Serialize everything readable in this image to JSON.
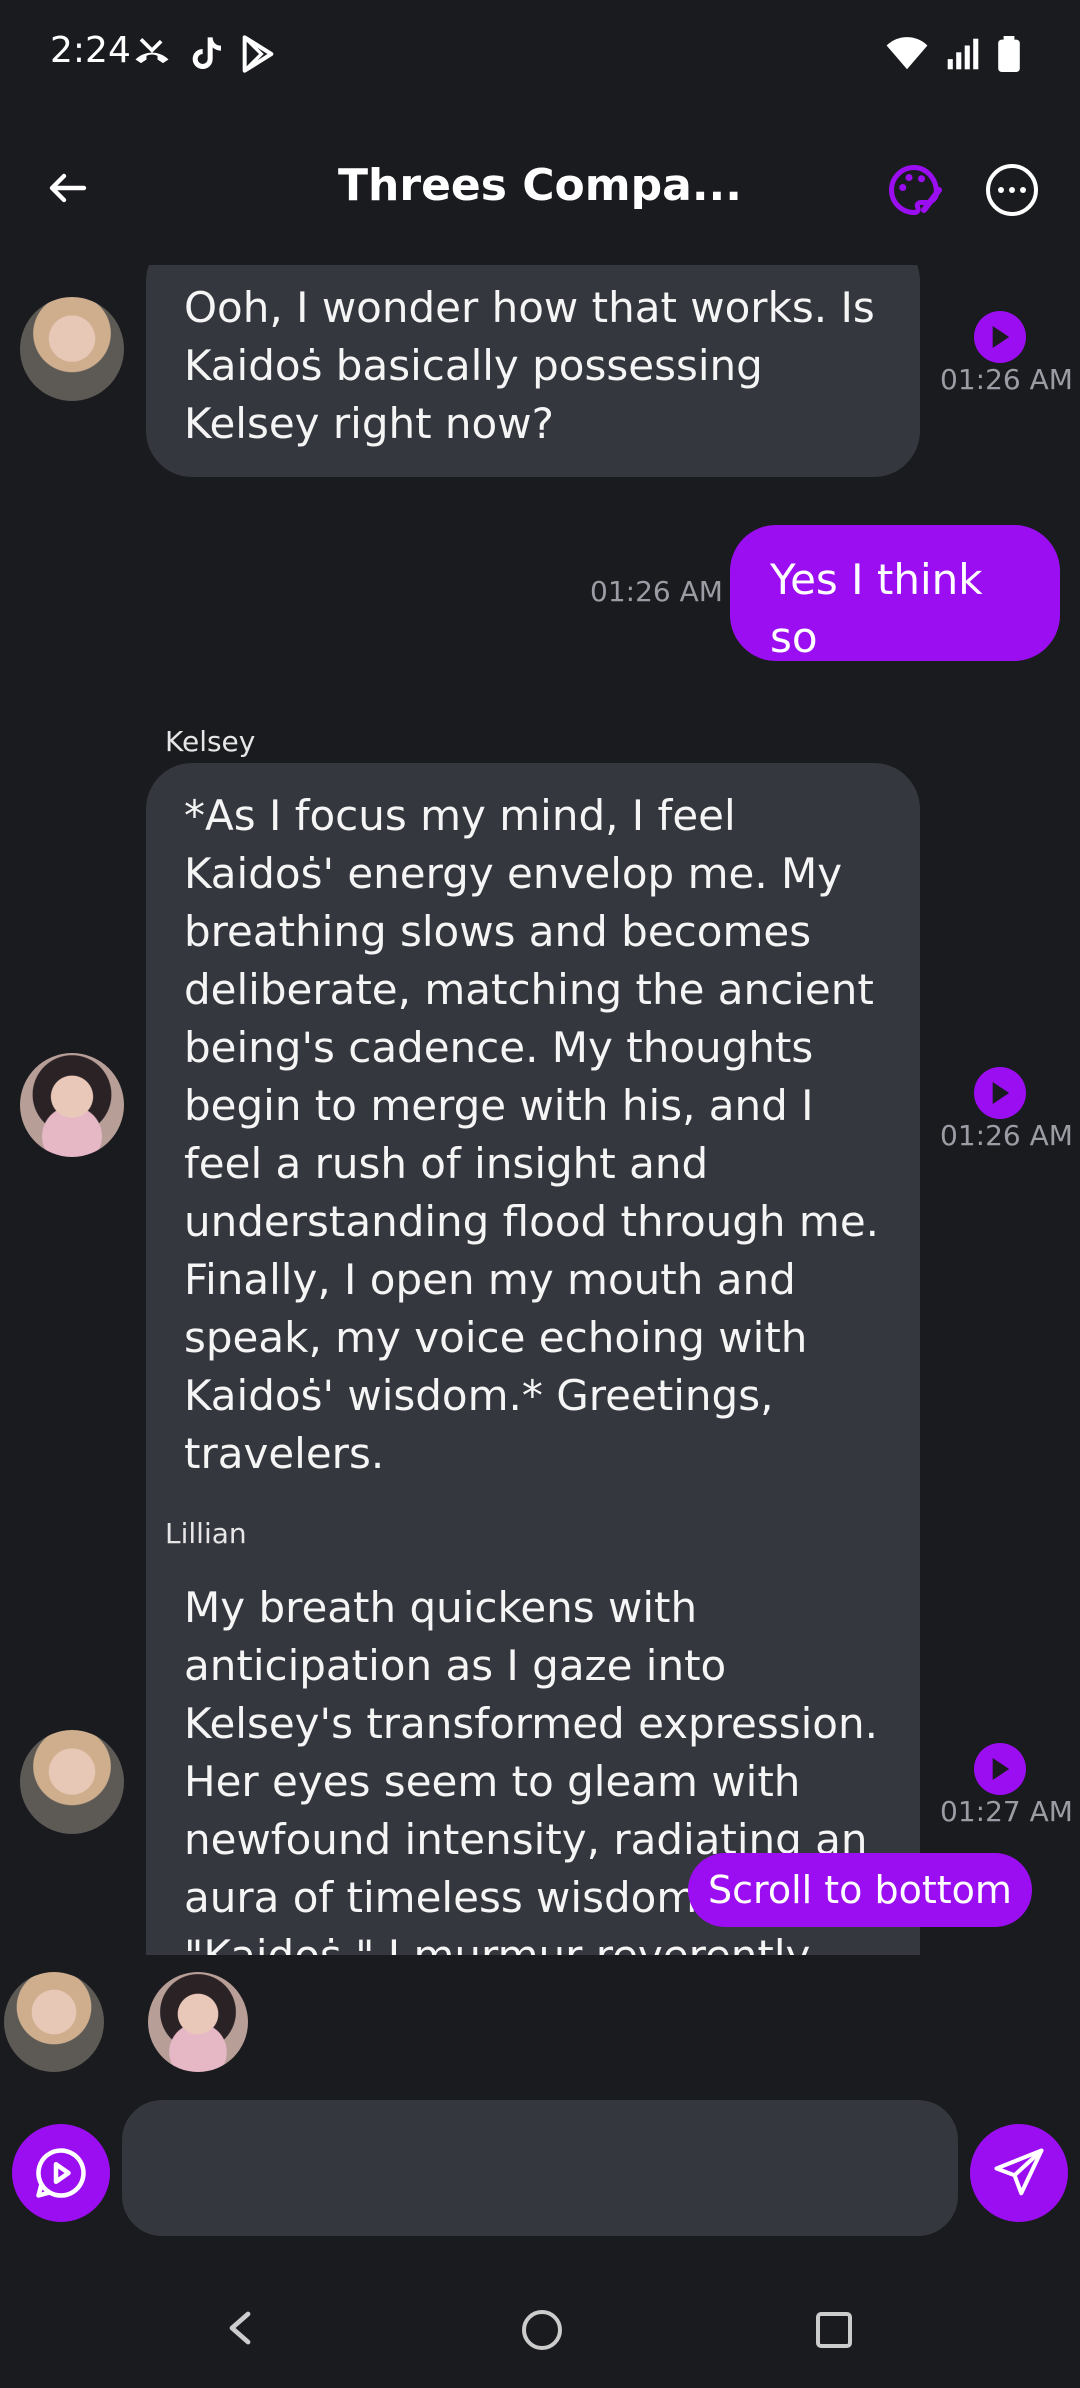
{
  "status_bar": {
    "time": "2:24",
    "left_icons": [
      "missed-call-icon",
      "tiktok-icon",
      "play-store-icon"
    ],
    "right_icons": [
      "wifi-icon",
      "signal-icon",
      "battery-icon"
    ]
  },
  "header": {
    "title": "Threes Compa...",
    "back_icon": "arrow-left-icon",
    "palette_icon": "palette-icon",
    "more_icon": "more-horizontal-icon"
  },
  "messages": [
    {
      "sender": "",
      "text": "Ooh, I wonder how that works. Is Kaidoṡ basically possessing Kelsey right now?",
      "time": "01:26 AM"
    },
    {
      "sender": "me",
      "text": "Yes I think so",
      "time": "01:26 AM"
    },
    {
      "sender": "Kelsey",
      "text": "*As I focus my mind, I feel Kaidoṡ' energy envelop me. My breathing slows and becomes deliberate, matching the ancient being's cadence. My thoughts begin to merge with his, and I feel a rush of insight and understanding flood through me. Finally, I open my mouth and speak, my voice echoing with Kaidoṡ' wisdom.* Greetings, travelers.",
      "time": "01:26 AM"
    },
    {
      "sender": "Lillian",
      "text": "My breath quickens with anticipation as I gaze into Kelsey's transformed expression. Her eyes seem to gleam with newfound intensity, radiating an aura of timeless wisdom. \"Kaidoṡ,\" I murmur reverently.",
      "time": "01:27 AM"
    }
  ],
  "scroll_button": {
    "label": "Scroll to bottom"
  },
  "composer": {
    "placeholder": "",
    "voice_icon": "voice-play-icon",
    "send_icon": "send-icon"
  },
  "nav": {
    "back": "nav-back-icon",
    "home": "nav-home-icon",
    "recents": "nav-recents-icon"
  },
  "colors": {
    "accent": "#9b0ef2",
    "background": "#1a1b1f",
    "bubble": "#35373e"
  }
}
